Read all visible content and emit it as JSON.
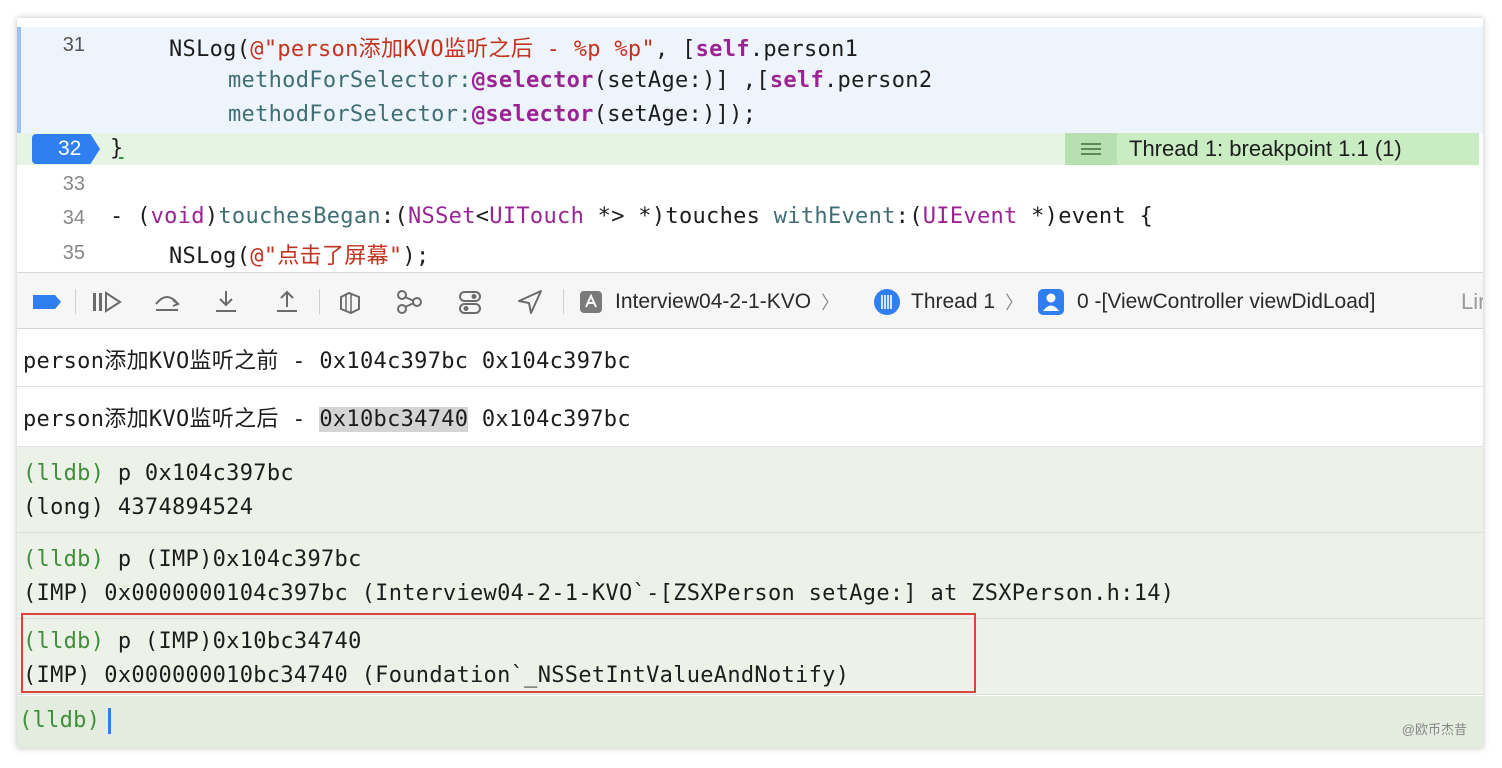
{
  "editor": {
    "lines": [
      {
        "num": "31",
        "text_a": "NSLog(",
        "text_str": "@\"person添加KVO监听之后 - %p %p\"",
        "text_b": ", [",
        "kw1": "self",
        "text_c": ".person1"
      },
      {
        "cont1_meth": "methodForSelector:",
        "cont1_kw": "@selector",
        "cont1_rest": "(setAge:)] ,[",
        "cont1_kw2": "self",
        "cont1_tail": ".person2"
      },
      {
        "cont2_meth": "methodForSelector:",
        "cont2_kw": "@selector",
        "cont2_rest": "(setAge:)]);"
      },
      {
        "num": "32",
        "text": "}"
      },
      {
        "num": "33",
        "text": ""
      },
      {
        "num": "34",
        "dash": "- (",
        "kw": "void",
        "paren": ")",
        "meth": "touchesBegan",
        "colon": ":(",
        "cls": "NSSet",
        "lt": "<",
        "cls2": "UITouch",
        "rest": " *> *)touches ",
        "meth2": "withEvent",
        "colon2": ":(",
        "cls3": "UIEvent",
        "tail": " *)event {"
      },
      {
        "num": "35",
        "text_a": "NSLog(",
        "text_str": "@\"点击了屏幕\"",
        "text_b": ");"
      }
    ],
    "breakpoint_label": "Thread 1: breakpoint 1.1 (1)"
  },
  "toolbar": {
    "target": "Interview04-2-1-KVO",
    "thread": "Thread 1",
    "frame": "0 -[ViewController viewDidLoad]",
    "overflow": "Lir"
  },
  "console": {
    "out1": "person添加KVO监听之前 - 0x104c397bc 0x104c397bc",
    "out2_pre": "person添加KVO监听之后 - ",
    "out2_sel": "0x10bc34740",
    "out2_post": " 0x104c397bc",
    "cmd1_prompt": "(lldb)",
    "cmd1": " p 0x104c397bc",
    "cmd1_result": "(long) 4374894524",
    "cmd2_prompt": "(lldb)",
    "cmd2": " p (IMP)0x104c397bc",
    "cmd2_result": "(IMP) 0x0000000104c397bc (Interview04-2-1-KVO`-[ZSXPerson setAge:] at ZSXPerson.h:14)",
    "cmd3_prompt": "(lldb)",
    "cmd3": " p (IMP)0x10bc34740",
    "cmd3_result": "(IMP) 0x000000010bc34740 (Foundation`_NSSetIntValueAndNotify)",
    "prompt": "(lldb)"
  },
  "watermark": "@欧币杰昔",
  "colors": {
    "breakpoint": "#2f7ff0",
    "lldb_prompt": "#3e8f3a",
    "string": "#c3331f",
    "keyword": "#9b2393",
    "highlight_box": "#d9453a"
  }
}
